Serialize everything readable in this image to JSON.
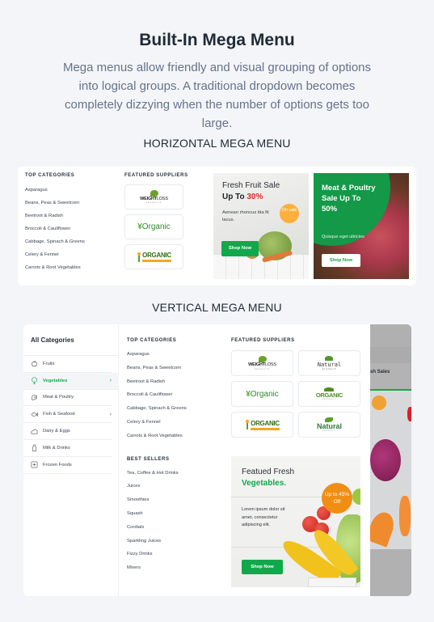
{
  "hero": {
    "title": "Built-In Mega Menu",
    "subtitle": "Mega menus allow friendly and visual grouping of options into logical groups. A traditional dropdown becomes completely dizzying when the number of options gets too large."
  },
  "horizontal": {
    "section_title": "HORIZONTAL MEGA MENU",
    "top_categories": {
      "heading": "TOP CATEGORIES",
      "items": [
        "Asparagus",
        "Beans, Peas & Sweetcorn",
        "Beetroot & Radish",
        "Broccoli & Cauliflower",
        "Cabbage, Spinach & Greens",
        "Celery & Fennel",
        "Carrots & Root Vegetables"
      ]
    },
    "featured_suppliers": {
      "heading": "FEATURED SUPPLIERS",
      "logos": [
        {
          "name": "weight-loss-logo",
          "text": "WEIGHT",
          "text2": "LOSS",
          "sub": "PRODUCTS"
        },
        {
          "name": "organic-logo",
          "text": "Organic"
        },
        {
          "name": "organic-bold-logo",
          "text": "ORGANIC"
        }
      ]
    },
    "promo_fruit": {
      "line1": "Fresh Fruit Sale",
      "line2_prefix": "Up To ",
      "line2_highlight": "30%",
      "desc": "Aenean rhoncus bla fit lacus.",
      "badge": "On sale",
      "button": "Shop Now"
    },
    "promo_meat": {
      "headline": "Meat & Poultry Sale Up To 50%",
      "desc": "Quisque eget ultricies",
      "button": "Shop Now"
    }
  },
  "vertical": {
    "section_title": "VERTICAL MEGA MENU",
    "sidebar": {
      "title": "All Categories",
      "items": [
        {
          "label": "Fruits",
          "icon": "apple-icon",
          "active": false,
          "has_submenu": false
        },
        {
          "label": "Vegetables",
          "icon": "broccoli-icon",
          "active": true,
          "has_submenu": true
        },
        {
          "label": "Meat & Poultry",
          "icon": "meat-icon",
          "active": false,
          "has_submenu": false
        },
        {
          "label": "Fish & Seafood",
          "icon": "fish-icon",
          "active": false,
          "has_submenu": true
        },
        {
          "label": "Dairy & Eggs",
          "icon": "cheese-icon",
          "active": false,
          "has_submenu": false
        },
        {
          "label": "Milk & Drinks",
          "icon": "milk-bottle-icon",
          "active": false,
          "has_submenu": false
        },
        {
          "label": "Frozen Foods",
          "icon": "frozen-icon",
          "active": false,
          "has_submenu": false
        }
      ],
      "chevron": "›"
    },
    "top_categories": {
      "heading": "TOP CATEGORIES",
      "items": [
        "Asparagus",
        "Beans, Peas & Sweetcorn",
        "Beetroot & Radish",
        "Broccoli & Cauliflower",
        "Cabbage, Spinach & Greens",
        "Celery & Fennel",
        "Carrots & Root Vegetables"
      ]
    },
    "best_sellers": {
      "heading": "BEST SELLERS",
      "items": [
        "Tea, Coffee & Hot Drinks",
        "Juices",
        "Smoothies",
        "Squash",
        "Cordials",
        "Sparkling Juices",
        "Fizzy Drinks",
        "Mixers"
      ]
    },
    "featured_suppliers": {
      "heading": "FEATURED SUPPLIERS",
      "logos": [
        {
          "name": "weight-loss-logo",
          "text": "WEIGHT",
          "text2": "LOSS",
          "sub": "PRODUCTS"
        },
        {
          "name": "natural-product-logo",
          "text": "Natural",
          "sub": "product"
        },
        {
          "name": "organic-logo",
          "text": "Organic"
        },
        {
          "name": "organic-product-logo",
          "text": "ORGANIC",
          "sub": "PRODUCT"
        },
        {
          "name": "organic-bold-logo",
          "text": "ORGANIC"
        },
        {
          "name": "natural-product-green-logo",
          "text": "Natural",
          "sub": "PRODUCT"
        }
      ]
    },
    "promo_veg": {
      "line1": "Featued Fresh",
      "line2": "Vegetables.",
      "desc": "Lorem ipsum dolor sit amet, consectetur adipiscing elit.",
      "badge": "Up to 45% Off",
      "button": "Shop Now"
    },
    "background_page": {
      "tab_text": "sh Sales"
    }
  },
  "colors": {
    "accent_green": "#11a84b",
    "sale_red": "#e0262a",
    "badge_yellow": "#fbb03b",
    "badge_orange": "#f08e14",
    "page_bg": "#f3f5f8"
  }
}
